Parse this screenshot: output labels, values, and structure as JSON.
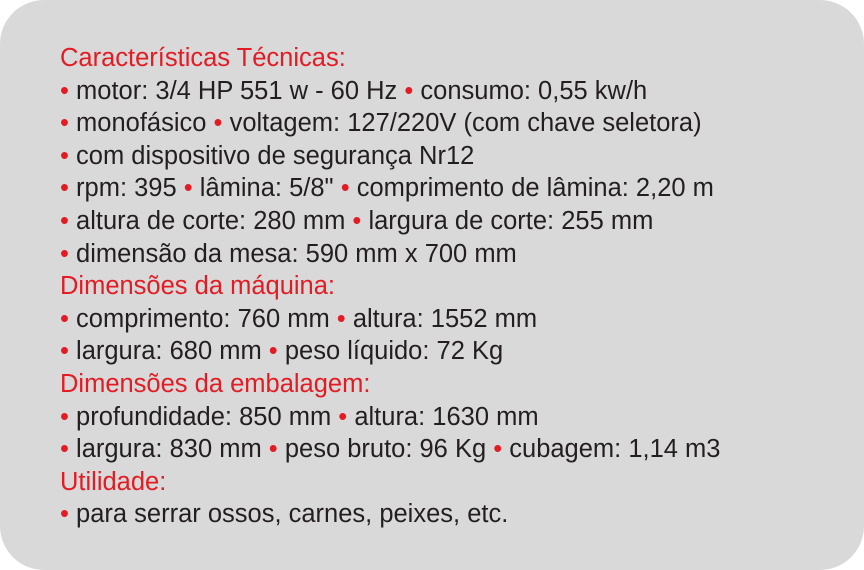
{
  "colors": {
    "background": "#d9d9da",
    "heading": "#e31b23",
    "bullet": "#e31b23",
    "text": "#231f20"
  },
  "bullet_char": "•",
  "sections": [
    {
      "heading": "Características Técnicas:",
      "lines": [
        [
          "motor: 3/4 HP 551 w - 60 Hz",
          "consumo: 0,55 kw/h"
        ],
        [
          "monofásico",
          "voltagem: 127/220V (com chave seletora)"
        ],
        [
          "com dispositivo de segurança Nr12"
        ],
        [
          "rpm: 395",
          "lâmina: 5/8\"",
          "comprimento de lâmina: 2,20 m"
        ],
        [
          "altura de corte: 280 mm",
          "largura de corte: 255 mm"
        ],
        [
          "dimensão da mesa: 590 mm x 700 mm"
        ]
      ]
    },
    {
      "heading": "Dimensões da máquina:",
      "lines": [
        [
          "comprimento: 760 mm",
          "altura: 1552 mm"
        ],
        [
          "largura: 680 mm",
          "peso líquido: 72 Kg"
        ]
      ]
    },
    {
      "heading": "Dimensões da embalagem:",
      "lines": [
        [
          "profundidade: 850 mm",
          "altura: 1630 mm"
        ],
        [
          "largura: 830 mm",
          "peso bruto: 96 Kg",
          "cubagem: 1,14 m3"
        ]
      ]
    },
    {
      "heading": "Utilidade:",
      "lines": [
        [
          "para serrar ossos, carnes, peixes, etc."
        ]
      ]
    }
  ]
}
